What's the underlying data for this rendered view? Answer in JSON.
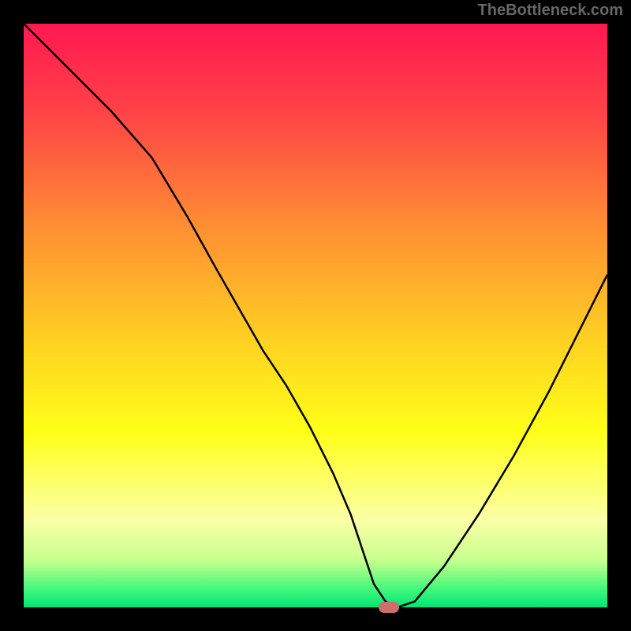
{
  "watermark_text": "TheBottleneck.com",
  "marker_color": "#cf6d6d",
  "chart_data": {
    "type": "line",
    "title": "",
    "xlabel": "",
    "ylabel": "",
    "xlim": [
      0,
      100
    ],
    "ylim": [
      0,
      100
    ],
    "grid": false,
    "legend": false,
    "background_gradient_stops": [
      {
        "offset": 0.0,
        "color": "#ff1851"
      },
      {
        "offset": 0.15,
        "color": "#ff4247"
      },
      {
        "offset": 0.35,
        "color": "#ff8f33"
      },
      {
        "offset": 0.55,
        "color": "#ffd321"
      },
      {
        "offset": 0.7,
        "color": "#ffff18"
      },
      {
        "offset": 0.85,
        "color": "#fbffa6"
      },
      {
        "offset": 0.92,
        "color": "#c7ff8e"
      },
      {
        "offset": 0.965,
        "color": "#4cf97b"
      },
      {
        "offset": 1.0,
        "color": "#00e676"
      }
    ],
    "series": [
      {
        "name": "bottleneck-curve",
        "x": [
          0,
          7,
          15,
          22,
          28,
          33,
          37,
          41,
          45,
          49,
          53,
          56,
          58,
          60,
          62,
          64,
          67,
          72,
          78,
          84,
          90,
          95,
          100
        ],
        "y": [
          100,
          93,
          85,
          77,
          67,
          58,
          51,
          44,
          38,
          31,
          23,
          16,
          10,
          4,
          1,
          0,
          1,
          7,
          16,
          26,
          37,
          47,
          57
        ]
      }
    ],
    "marker": {
      "x": 62.5,
      "y": 0
    }
  }
}
